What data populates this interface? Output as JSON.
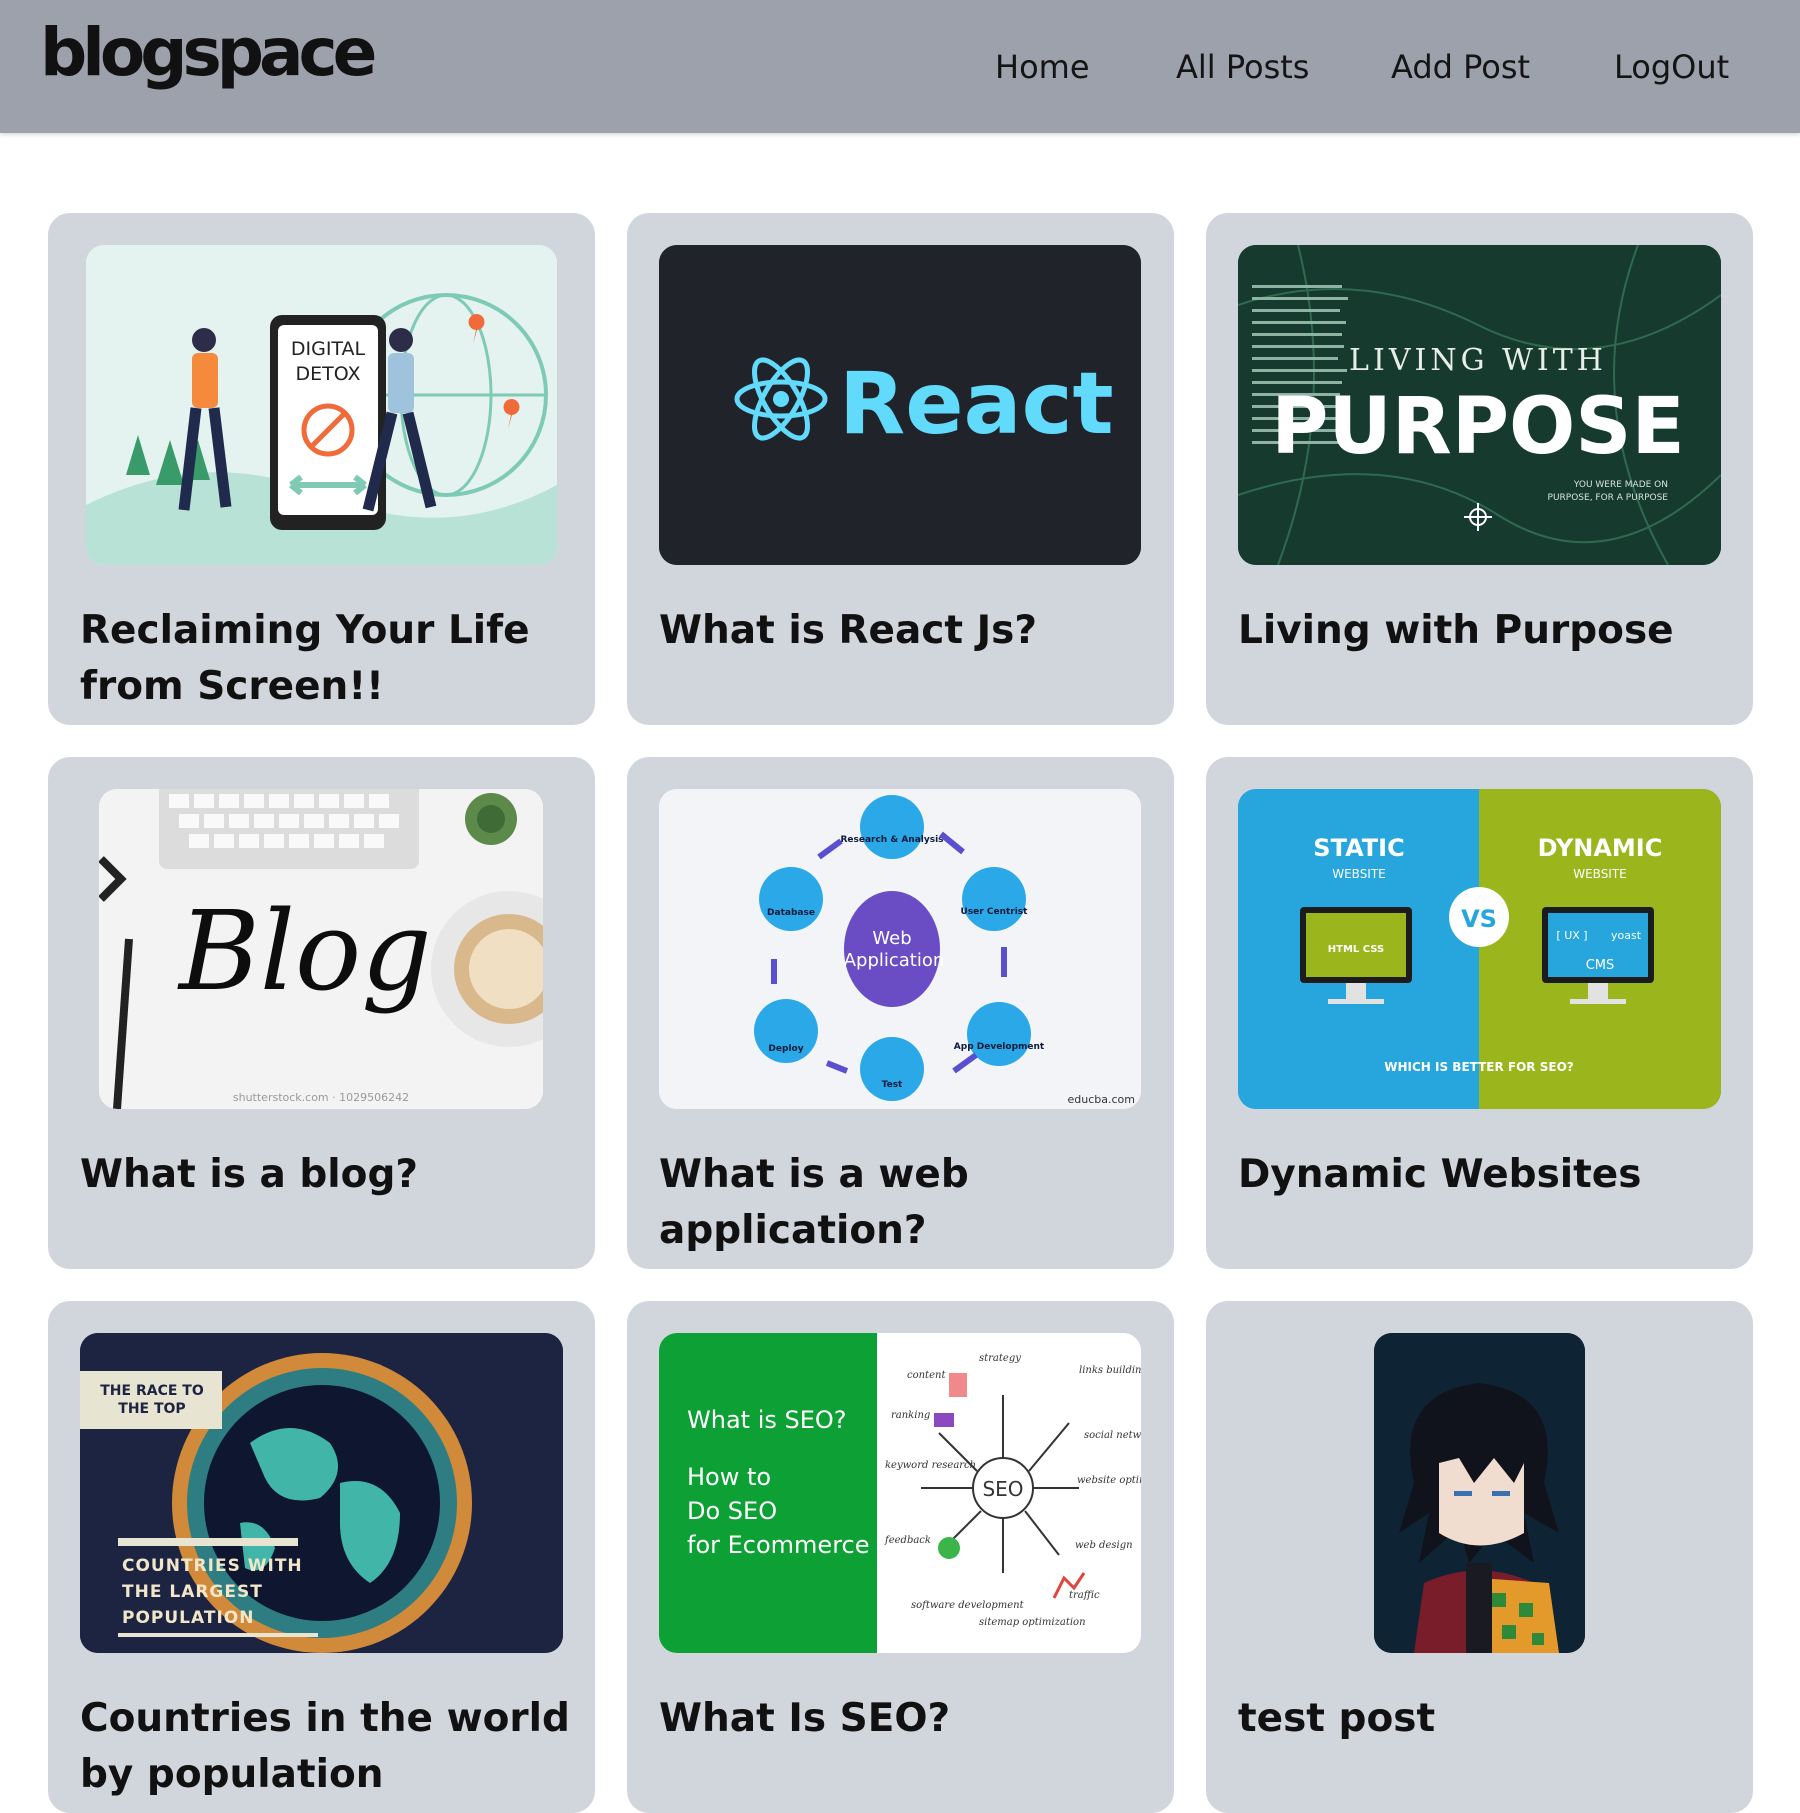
{
  "brand": {
    "logo_text": "blogspace"
  },
  "nav": {
    "home": "Home",
    "all_posts": "All Posts",
    "add_post": "Add Post",
    "logout": "LogOut"
  },
  "posts": [
    {
      "title": "Reclaiming Your Life from Screen!!",
      "image_text": [
        "DIGITAL",
        "DETOX"
      ]
    },
    {
      "title": "What is React Js?",
      "image_text": [
        "React"
      ]
    },
    {
      "title": "Living with Purpose",
      "image_text": [
        "LIVING WITH",
        "PURPOSE",
        "YOU WERE MADE ON",
        "PURPOSE, FOR A PURPOSE"
      ]
    },
    {
      "title": "What is a blog?",
      "image_text": [
        "Blog",
        "shutterstock.com · 1029506242"
      ]
    },
    {
      "title": "What is a web application?",
      "image_text": [
        "Web",
        "Application",
        "Research & Analysis",
        "User Centrist",
        "App Development",
        "Test",
        "Deploy",
        "Database",
        "educba.com"
      ]
    },
    {
      "title": "Dynamic Websites",
      "image_text": [
        "STATIC",
        "WEBSITE",
        "DYNAMIC",
        "WEBSITE",
        "VS",
        "WHICH IS BETTER FOR SEO?",
        "HTML CSS",
        "[ UX ]",
        "yoast",
        "CMS"
      ]
    },
    {
      "title": "Countries in the world by population",
      "image_text": [
        "THE RACE TO",
        "THE TOP",
        "COUNTRIES WITH",
        "THE LARGEST",
        "POPULATION"
      ]
    },
    {
      "title": "What Is SEO?",
      "image_text": [
        "What is SEO?",
        "How to",
        "Do SEO",
        "for Ecommerce",
        "SEO",
        "content",
        "strategy",
        "links building",
        "ranking",
        "social network",
        "keyword research",
        "website optimization",
        "feedback",
        "web design",
        "software development",
        "sitemap optimization",
        "traffic"
      ]
    },
    {
      "title": "test post",
      "image_text": []
    }
  ],
  "colors": {
    "navbar": "#9ca1ac",
    "card": "#d1d5dc",
    "react_blue": "#61dafb",
    "seo_green": "#0ca035"
  }
}
